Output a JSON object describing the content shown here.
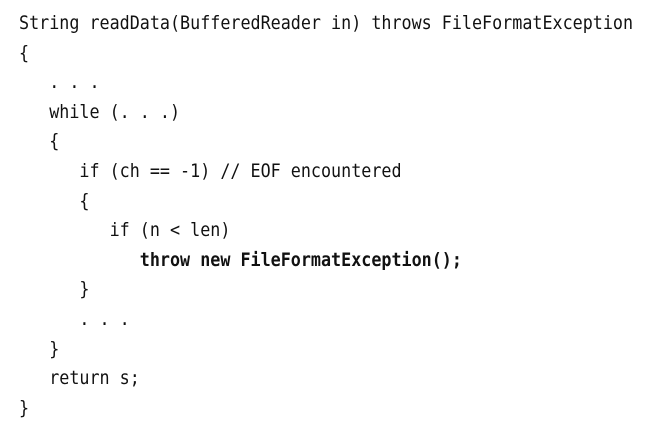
{
  "code": {
    "lines": [
      {
        "text": "String readData(BufferedReader in) throws FileFormatException",
        "bold": false
      },
      {
        "text": "{",
        "bold": false
      },
      {
        "text": "   . . .",
        "bold": false
      },
      {
        "text": "   while (. . .)",
        "bold": false
      },
      {
        "text": "   {",
        "bold": false
      },
      {
        "text": "      if (ch == -1) // EOF encountered",
        "bold": false
      },
      {
        "text": "      {",
        "bold": false
      },
      {
        "text": "         if (n < len)",
        "bold": false
      },
      {
        "text": "            throw new FileFormatException();",
        "bold": true
      },
      {
        "text": "      }",
        "bold": false
      },
      {
        "text": "      . . .",
        "bold": false
      },
      {
        "text": "   }",
        "bold": false
      },
      {
        "text": "   return s;",
        "bold": false
      },
      {
        "text": "}",
        "bold": false
      }
    ]
  }
}
